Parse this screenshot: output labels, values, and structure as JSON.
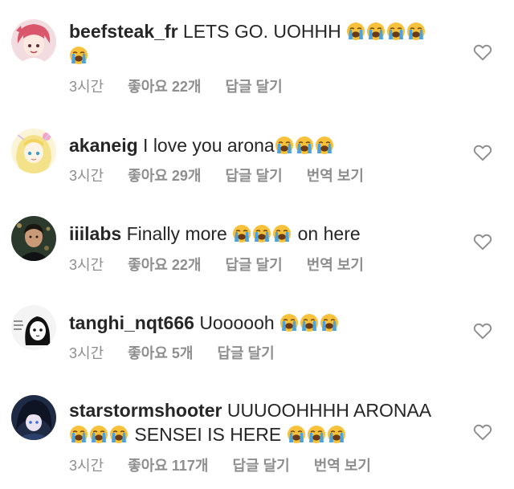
{
  "comments": [
    {
      "username": "beefsteak_fr",
      "text_before": "LETS GO. UOHHH ",
      "emoji_count": 5,
      "text_after": "",
      "time": "3시간",
      "likes": "좋아요 22개",
      "reply": "답글 달기",
      "translate": ""
    },
    {
      "username": "akaneig",
      "text_before": "I love you arona",
      "emoji_count": 3,
      "text_after": "",
      "time": "3시간",
      "likes": "좋아요 29개",
      "reply": "답글 달기",
      "translate": "번역 보기"
    },
    {
      "username": "iiilabs",
      "text_before": "Finally more ",
      "emoji_count": 3,
      "text_after": " on here",
      "time": "3시간",
      "likes": "좋아요 22개",
      "reply": "답글 달기",
      "translate": "번역 보기"
    },
    {
      "username": "tanghi_nqt666",
      "text_before": "Uoooooh ",
      "emoji_count": 3,
      "text_after": "",
      "time": "3시간",
      "likes": "좋아요 5개",
      "reply": "답글 달기",
      "translate": ""
    },
    {
      "username": "starstormshooter",
      "text_before": "UUUOOHHHH ARONAA ",
      "emoji_count": 3,
      "text_after": " SENSEI IS HERE ",
      "emoji_count_after": 3,
      "time": "3시간",
      "likes": "좋아요 117개",
      "reply": "답글 달기",
      "translate": "번역 보기"
    }
  ],
  "icons": {
    "emoji": "loudly-crying-face-icon",
    "like": "heart-outline-icon"
  },
  "colors": {
    "text": "#262626",
    "meta": "#8e8e8e",
    "emoji_face": "#f7c13b",
    "emoji_tears": "#4aa3df"
  }
}
